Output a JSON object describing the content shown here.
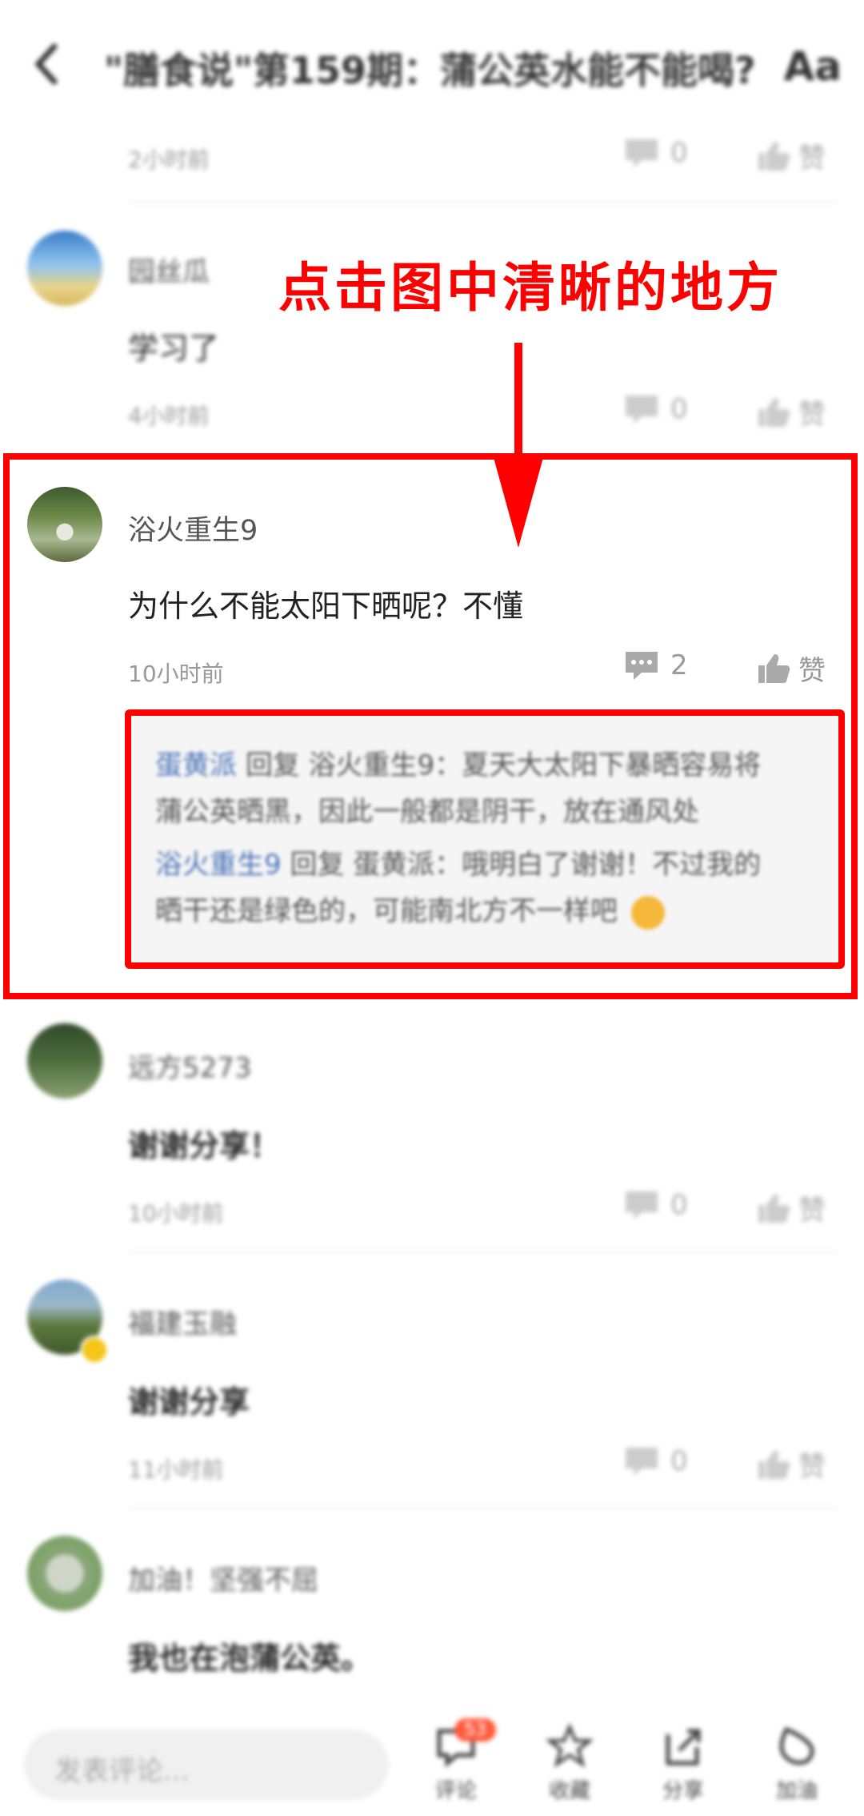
{
  "header": {
    "title": "\"膳食说\"第159期：蒲公英水能不能喝?",
    "font_toggle": "Aa"
  },
  "annotation": {
    "text": "点击图中清晰的地方"
  },
  "comments": [
    {
      "time": "2小时前",
      "replies": "0",
      "like": "赞"
    },
    {
      "user": "园丝瓜",
      "text": "学习了",
      "time": "4小时前",
      "replies": "0",
      "like": "赞"
    },
    {
      "user": "浴火重生9",
      "text": "为什么不能太阳下晒呢？不懂",
      "time": "10小时前",
      "replies": "2",
      "like": "赞",
      "thread": [
        {
          "from": "蛋黄派",
          "verb": "回复",
          "to": "浴火重生9",
          "msg_line1": "：夏天大太阳下暴晒容易将",
          "msg_line2": "蒲公英晒黑，因此一般都是阴干，放在通风处"
        },
        {
          "from": "浴火重生9",
          "verb": "回复",
          "to": "蛋黄派",
          "msg_line1": "：哦明白了谢谢！不过我的",
          "msg_line2": "晒干还是绿色的，可能南北方不一样吧"
        }
      ]
    },
    {
      "user": "远方5273",
      "text": "谢谢分享！",
      "time": "10小时前",
      "replies": "0",
      "like": "赞"
    },
    {
      "user": "福建玉融",
      "text": "谢谢分享",
      "time": "11小时前",
      "replies": "0",
      "like": "赞"
    },
    {
      "user": "加油！坚强不屈",
      "text": "我也在泡蒲公英。"
    }
  ],
  "bottom_bar": {
    "input_placeholder": "发表评论...",
    "comment_label": "评论",
    "comment_badge": "53",
    "collect_label": "收藏",
    "share_label": "分享",
    "cheer_label": "加油"
  },
  "colors": {
    "highlight": "#ff0000",
    "badge": "#ff5a3c",
    "link": "#4a74b8"
  }
}
